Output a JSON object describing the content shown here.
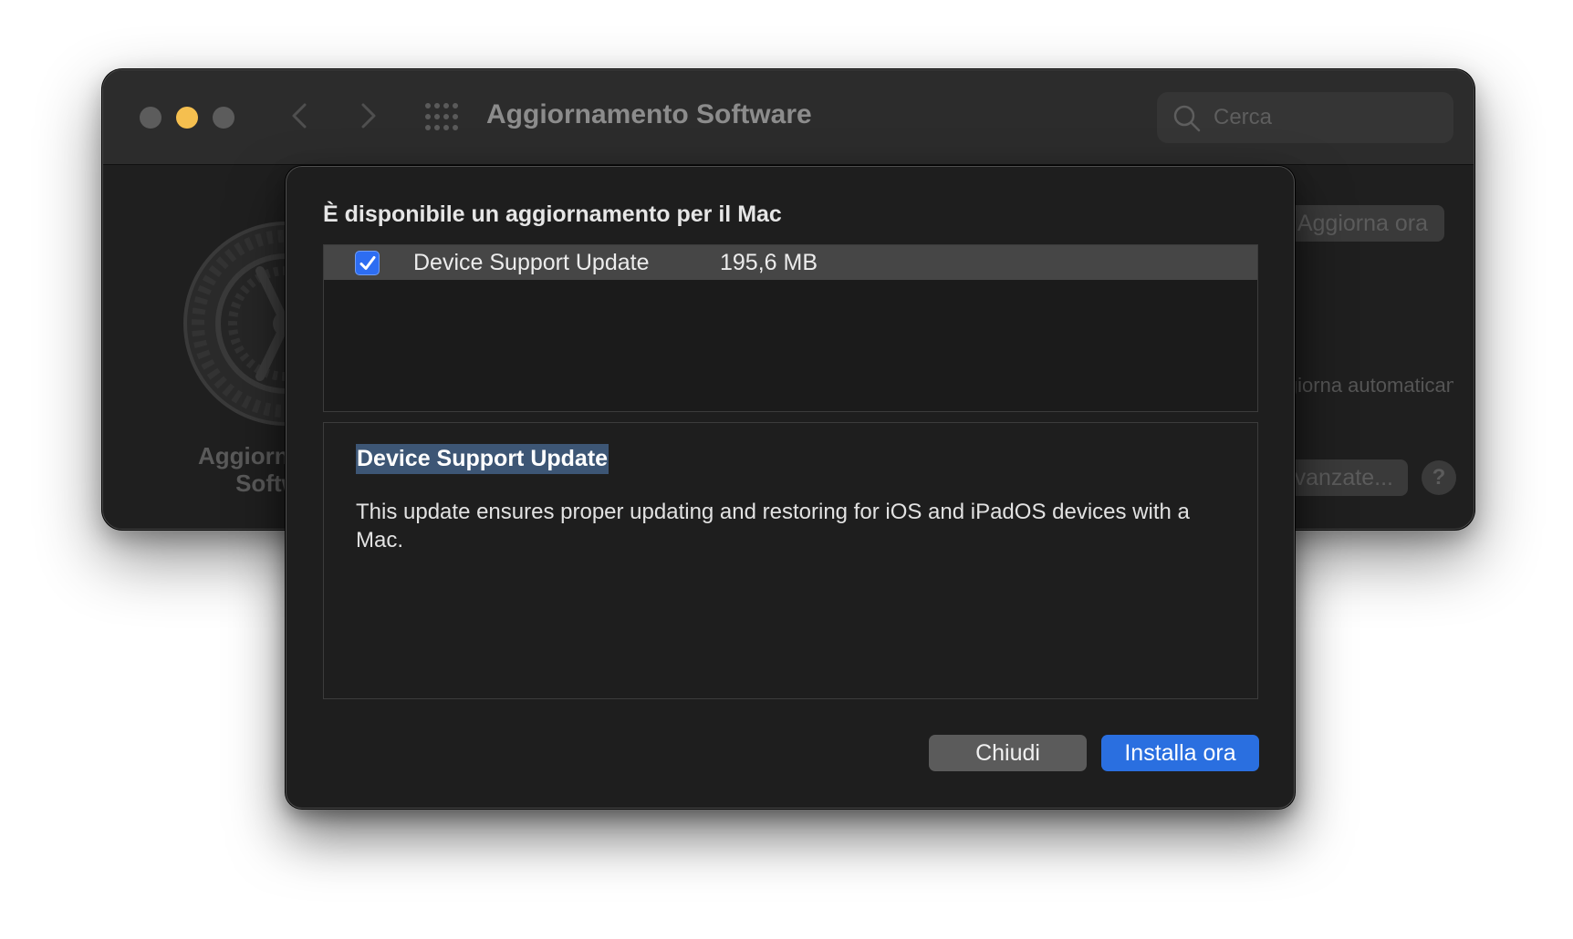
{
  "window": {
    "title": "Aggiornamento Software",
    "search_placeholder": "Cerca",
    "app_name": "Aggiornamento Software",
    "update_now_label": "Aggiorna ora",
    "auto_update_text": "Aggiorna automaticamente il software",
    "advanced_label": "Avanzate...",
    "help_label": "?"
  },
  "sheet": {
    "title": "È disponibile un aggiornamento per il Mac",
    "updates": [
      {
        "name": "Device Support Update",
        "size": "195,6 MB",
        "checked": true
      }
    ],
    "details": {
      "title": "Device Support Update",
      "description": "This update ensures proper updating and restoring for iOS and iPadOS devices with a Mac."
    },
    "buttons": {
      "close_label": "Chiudi",
      "install_label": "Installa ora"
    }
  },
  "colors": {
    "accent": "#2a6fe0",
    "selection": "#3d5675",
    "minimize": "#f5bf4f"
  }
}
